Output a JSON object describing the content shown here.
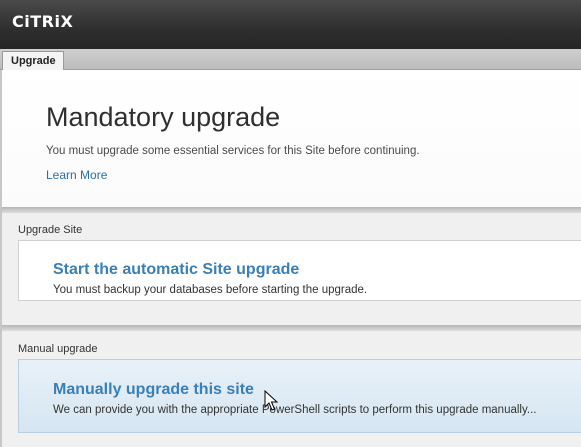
{
  "header": {
    "logo": "CiTRiX"
  },
  "tabs": [
    {
      "label": "Upgrade"
    }
  ],
  "intro": {
    "title": "Mandatory upgrade",
    "description": "You must upgrade some essential services for this Site before continuing.",
    "learn_more": "Learn More"
  },
  "upgrade_site": {
    "section_label": "Upgrade Site",
    "card_title": "Start the automatic Site upgrade",
    "card_desc": "You must backup your databases before starting the upgrade."
  },
  "manual_upgrade": {
    "section_label": "Manual upgrade",
    "card_title": "Manually upgrade this site",
    "card_desc": "We can provide you with the appropriate PowerShell scripts to perform this upgrade manually..."
  },
  "colors": {
    "link": "#2a6fa8",
    "card_title": "#3a7fb5",
    "header_bg": "#2e2e2e"
  }
}
